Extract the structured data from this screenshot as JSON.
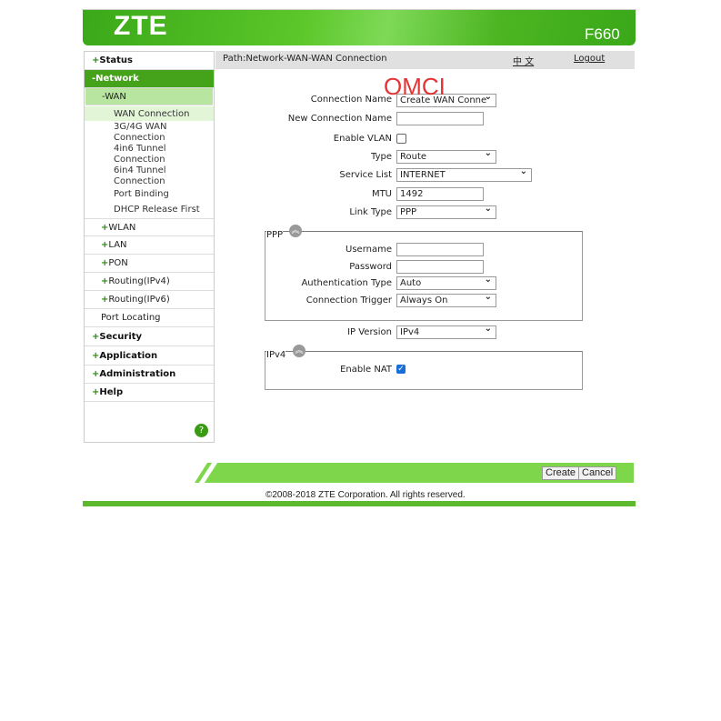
{
  "header": {
    "logo": "ZTE",
    "model": "F660"
  },
  "sidebar": {
    "items": [
      {
        "label": "Status",
        "prefix": "+"
      },
      {
        "label": "Network",
        "prefix": "-"
      },
      {
        "label": "-WAN"
      },
      {
        "label": "WAN Connection"
      },
      {
        "label": "3G/4G WAN Connection"
      },
      {
        "label": "4in6 Tunnel Connection"
      },
      {
        "label": "6in4 Tunnel Connection"
      },
      {
        "label": "Port Binding"
      },
      {
        "label": "DHCP Release First"
      },
      {
        "label": "WLAN",
        "prefix": "+"
      },
      {
        "label": "LAN",
        "prefix": "+"
      },
      {
        "label": "PON",
        "prefix": "+"
      },
      {
        "label": "Routing(IPv4)",
        "prefix": "+"
      },
      {
        "label": "Routing(IPv6)",
        "prefix": "+"
      },
      {
        "label": "Port Locating"
      },
      {
        "label": "Security",
        "prefix": "+"
      },
      {
        "label": "Application",
        "prefix": "+"
      },
      {
        "label": "Administration",
        "prefix": "+"
      },
      {
        "label": "Help",
        "prefix": "+"
      }
    ],
    "help_icon": "?"
  },
  "path": {
    "text": "Path:Network-WAN-WAN Connection",
    "lang": "中 文",
    "logout": "Logout"
  },
  "watermark": "OMCI",
  "form": {
    "connection_name": {
      "label": "Connection Name",
      "value": "Create WAN Conne"
    },
    "new_connection_name": {
      "label": "New Connection Name",
      "value": ""
    },
    "enable_vlan": {
      "label": "Enable VLAN",
      "checked": false
    },
    "type": {
      "label": "Type",
      "value": "Route"
    },
    "service_list": {
      "label": "Service List",
      "value": "INTERNET"
    },
    "mtu": {
      "label": "MTU",
      "value": "1492"
    },
    "link_type": {
      "label": "Link Type",
      "value": "PPP"
    },
    "ppp": {
      "legend": "PPP",
      "username": {
        "label": "Username",
        "value": ""
      },
      "password": {
        "label": "Password",
        "value": ""
      },
      "auth_type": {
        "label": "Authentication Type",
        "value": "Auto"
      },
      "trigger": {
        "label": "Connection Trigger",
        "value": "Always On"
      }
    },
    "ip_version": {
      "label": "IP Version",
      "value": "IPv4"
    },
    "ipv4": {
      "legend": "IPv4",
      "enable_nat": {
        "label": "Enable NAT",
        "checked": true
      }
    }
  },
  "buttons": {
    "create": "Create",
    "cancel": "Cancel"
  },
  "footer": {
    "copyright": "©2008-2018 ZTE Corporation. All rights reserved."
  },
  "colors": {
    "brand_green": "#45a31b",
    "footer_green": "#7ed64a"
  }
}
